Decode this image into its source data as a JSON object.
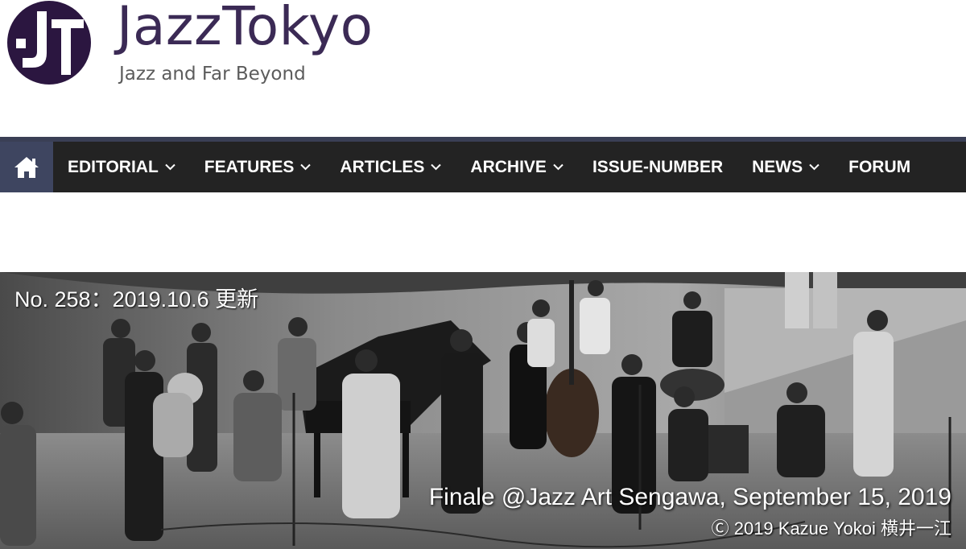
{
  "site": {
    "title": "JazzTokyo",
    "tagline": "Jazz and Far Beyond",
    "brand_color": "#2b1640"
  },
  "nav": {
    "home_icon": "home-icon",
    "items": [
      {
        "label": "EDITORIAL",
        "has_dropdown": true
      },
      {
        "label": "FEATURES",
        "has_dropdown": true
      },
      {
        "label": "ARTICLES",
        "has_dropdown": true
      },
      {
        "label": "ARCHIVE",
        "has_dropdown": true
      },
      {
        "label": "ISSUE-NUMBER",
        "has_dropdown": false
      },
      {
        "label": "NEWS",
        "has_dropdown": true
      },
      {
        "label": "FORUM",
        "has_dropdown": false
      }
    ],
    "bar_color": "#232323",
    "home_bg": "#3e4560"
  },
  "hero": {
    "issue": "No. 258：2019.10.6 更新",
    "caption": "Finale @Jazz Art Sengawa, September 15, 2019",
    "credit": "Ⓒ 2019 Kazue Yokoi 横井一江"
  }
}
